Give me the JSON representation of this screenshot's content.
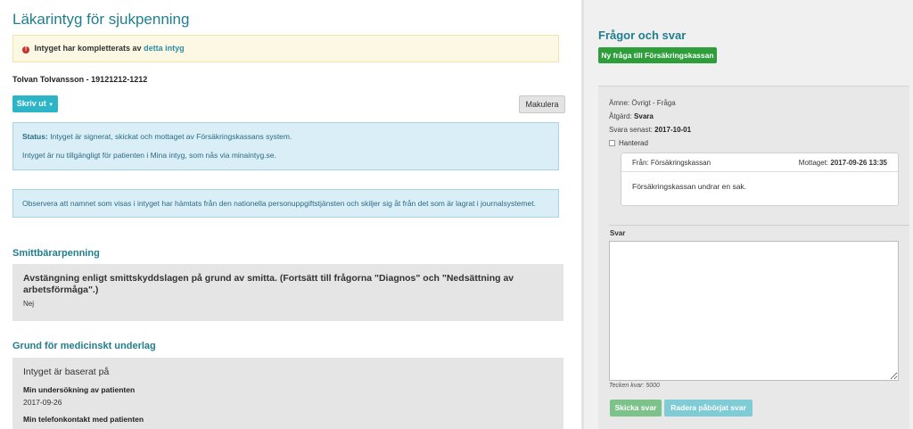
{
  "main": {
    "title": "Läkarintyg för sjukpenning",
    "warning": {
      "text": "Intyget har kompletterats av",
      "link": "detta intyg"
    },
    "patient": "Tolvan Tolvansson - 19121212-1212",
    "print_button": "Skriv ut",
    "cancel_button": "Makulera",
    "status": {
      "label": "Status:",
      "text": "Intyget är signerat, skickat och mottaget av Försäkringskassans system.",
      "availability": "Intyget är nu tillgängligt för patienten i Mina intyg, som nås via minaintyg.se."
    },
    "name_notice": "Observera att namnet som visas i intyget har hämtats från den nationella personuppgiftstjänsten och skiljer sig åt från det som är lagrat i journalsystemet.",
    "sections": {
      "smitt": {
        "title": "Smittbärarpenning",
        "question": "Avstängning enligt smittskyddslagen på grund av smitta. (Fortsätt till frågorna \"Diagnos\" och \"Nedsättning av arbetsförmåga\".)",
        "answer": "Nej"
      },
      "grund": {
        "title": "Grund för medicinskt underlag",
        "heading": "Intyget är baserat på",
        "item1_label": "Min undersökning av patienten",
        "item1_value": "2017-09-26",
        "item2_label": "Min telefonkontakt med patienten"
      }
    }
  },
  "qa": {
    "title": "Frågor och svar",
    "new_question_button": "Ny fråga till Försäkringskassan",
    "subject_label": "Ämne:",
    "subject_value": "Övrigt - Fråga",
    "action_label": "Åtgärd:",
    "action_value": "Svara",
    "deadline_label": "Svara senast:",
    "deadline_value": "2017-10-01",
    "handled_label": "Hanterad",
    "message": {
      "from": "Från: Försäkringskassan",
      "received_label": "Mottaget:",
      "received_value": "2017-09-26 13:35",
      "body": "Försäkringskassan undrar en sak."
    },
    "answer_label": "Svar",
    "chars_left": "Tecken kvar: 5000",
    "send_button": "Skicka svar",
    "delete_draft_button": "Radera påbörjat svar"
  },
  "colors": {
    "accent": "#1f7e8f",
    "primary_button": "#2bb5c7",
    "success_button": "#2e9e3b",
    "warning_bg": "#fcf8e3",
    "info_bg": "#d9eef6"
  }
}
